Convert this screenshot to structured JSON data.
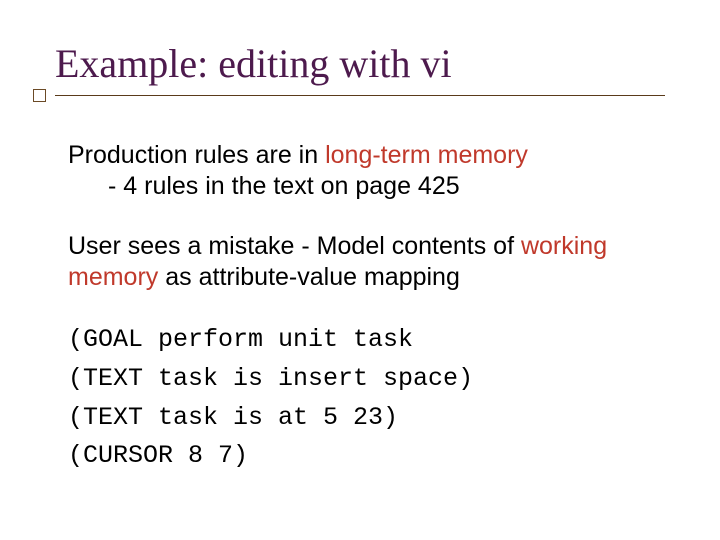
{
  "title": "Example: editing with vi",
  "p1": {
    "a": "Production rules are in ",
    "b": "long-term memory",
    "sub": "- 4 rules in the text on page 425"
  },
  "p2": {
    "a": "User sees a mistake - Model contents of ",
    "b": "working memory",
    "c": " as attribute-value mapping"
  },
  "code": {
    "l1": "(GOAL perform unit task",
    "l2": "(TEXT task is insert space)",
    "l3": "(TEXT task is at 5 23)",
    "l4": "(CURSOR 8 7)"
  }
}
